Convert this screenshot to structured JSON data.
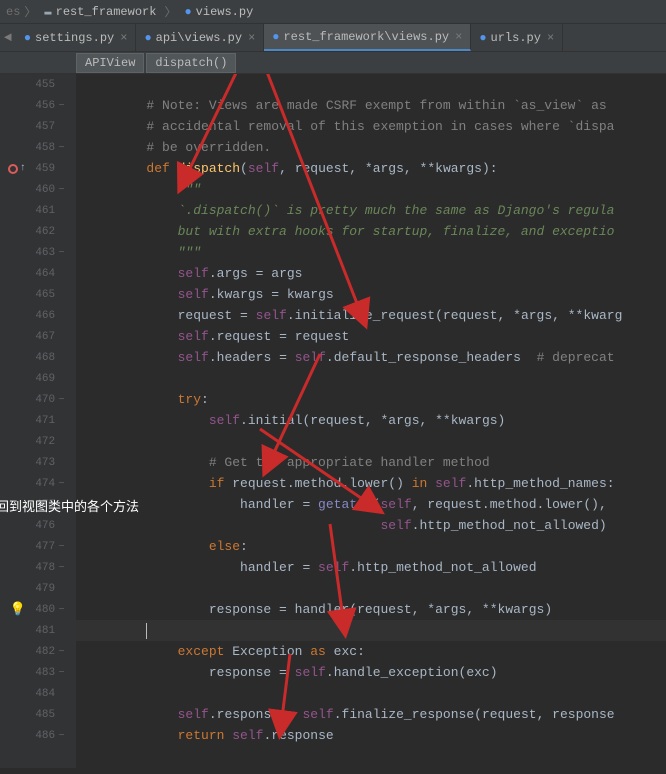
{
  "breadcrumb": {
    "part1": "rest_framework",
    "part2": "views.py",
    "left_chevron": "es"
  },
  "tabs": [
    {
      "label": "settings.py",
      "icon": "python",
      "active": false
    },
    {
      "label": "api\\views.py",
      "icon": "python",
      "active": false
    },
    {
      "label": "rest_framework\\views.py",
      "icon": "python",
      "active": true
    },
    {
      "label": "urls.py",
      "icon": "python",
      "active": false
    }
  ],
  "structure": [
    {
      "label": "APIView"
    },
    {
      "label": "dispatch()"
    }
  ],
  "annotation_text": "反射回到视图类中的各个方法",
  "lines": [
    {
      "num": "455",
      "tokens": []
    },
    {
      "num": "456",
      "fold": "−",
      "tokens": [
        [
          "comment",
          "        # Note: Views are made CSRF exempt from within `as_view` as "
        ]
      ]
    },
    {
      "num": "457",
      "tokens": [
        [
          "comment",
          "        # accidental removal of this exemption in cases where `dispa"
        ]
      ]
    },
    {
      "num": "458",
      "fold": "−",
      "tokens": [
        [
          "comment",
          "        # be overridden."
        ]
      ]
    },
    {
      "num": "459",
      "break": true,
      "override": true,
      "tokens": [
        [
          "keyword",
          "        def "
        ],
        [
          "funcname",
          "dispatch"
        ],
        [
          "punct",
          "("
        ],
        [
          "self",
          "self"
        ],
        [
          "punct",
          ", "
        ],
        [
          "param",
          "request"
        ],
        [
          "punct",
          ", *"
        ],
        [
          "param",
          "args"
        ],
        [
          "punct",
          ", **"
        ],
        [
          "param",
          "kwargs"
        ],
        [
          "punct",
          "):"
        ]
      ]
    },
    {
      "num": "460",
      "fold": "−",
      "tokens": [
        [
          "string",
          "            \"\"\""
        ]
      ]
    },
    {
      "num": "461",
      "tokens": [
        [
          "string",
          "            `.dispatch()` is pretty much the same as Django's regula"
        ]
      ]
    },
    {
      "num": "462",
      "tokens": [
        [
          "string",
          "            but with extra hooks for startup, finalize, and exceptio"
        ]
      ]
    },
    {
      "num": "463",
      "fold": "−",
      "tokens": [
        [
          "string",
          "            \"\"\""
        ]
      ]
    },
    {
      "num": "464",
      "tokens": [
        [
          "ident",
          "            "
        ],
        [
          "self",
          "self"
        ],
        [
          "punct",
          "."
        ],
        [
          "ident",
          "args "
        ],
        [
          "punct",
          "= "
        ],
        [
          "param",
          "args"
        ]
      ]
    },
    {
      "num": "465",
      "tokens": [
        [
          "ident",
          "            "
        ],
        [
          "self",
          "self"
        ],
        [
          "punct",
          "."
        ],
        [
          "ident",
          "kwargs "
        ],
        [
          "punct",
          "= "
        ],
        [
          "param",
          "kwargs"
        ]
      ]
    },
    {
      "num": "466",
      "tokens": [
        [
          "ident",
          "            request "
        ],
        [
          "punct",
          "= "
        ],
        [
          "self",
          "self"
        ],
        [
          "punct",
          "."
        ],
        [
          "ident",
          "initialize_request"
        ],
        [
          "punct",
          "("
        ],
        [
          "param",
          "request"
        ],
        [
          "punct",
          ", *"
        ],
        [
          "param",
          "args"
        ],
        [
          "punct",
          ", **"
        ],
        [
          "param",
          "kwarg"
        ]
      ]
    },
    {
      "num": "467",
      "tokens": [
        [
          "ident",
          "            "
        ],
        [
          "self",
          "self"
        ],
        [
          "punct",
          "."
        ],
        [
          "ident",
          "request "
        ],
        [
          "punct",
          "= "
        ],
        [
          "param",
          "request"
        ]
      ]
    },
    {
      "num": "468",
      "tokens": [
        [
          "ident",
          "            "
        ],
        [
          "self",
          "self"
        ],
        [
          "punct",
          "."
        ],
        [
          "ident",
          "headers "
        ],
        [
          "punct",
          "= "
        ],
        [
          "self",
          "self"
        ],
        [
          "punct",
          "."
        ],
        [
          "ident",
          "default_response_headers  "
        ],
        [
          "comment",
          "# deprecat"
        ]
      ]
    },
    {
      "num": "469",
      "tokens": []
    },
    {
      "num": "470",
      "fold": "−",
      "tokens": [
        [
          "ident",
          "            "
        ],
        [
          "keyword",
          "try"
        ],
        [
          "punct",
          ":"
        ]
      ]
    },
    {
      "num": "471",
      "tokens": [
        [
          "ident",
          "                "
        ],
        [
          "self",
          "self"
        ],
        [
          "punct",
          "."
        ],
        [
          "ident",
          "initial"
        ],
        [
          "punct",
          "("
        ],
        [
          "param",
          "request"
        ],
        [
          "punct",
          ", *"
        ],
        [
          "param",
          "args"
        ],
        [
          "punct",
          ", **"
        ],
        [
          "param",
          "kwargs"
        ],
        [
          "punct",
          ")"
        ]
      ]
    },
    {
      "num": "472",
      "tokens": []
    },
    {
      "num": "473",
      "tokens": [
        [
          "comment",
          "                # Get the appropriate handler method"
        ]
      ]
    },
    {
      "num": "474",
      "fold": "−",
      "tokens": [
        [
          "ident",
          "                "
        ],
        [
          "keyword",
          "if "
        ],
        [
          "param",
          "request"
        ],
        [
          "punct",
          "."
        ],
        [
          "ident",
          "method"
        ],
        [
          "punct",
          "."
        ],
        [
          "ident",
          "lower"
        ],
        [
          "punct",
          "() "
        ],
        [
          "keyword",
          "in "
        ],
        [
          "self",
          "self"
        ],
        [
          "punct",
          "."
        ],
        [
          "ident",
          "http_method_names"
        ],
        [
          "punct",
          ":"
        ]
      ]
    },
    {
      "num": "475",
      "tokens": [
        [
          "ident",
          "                    handler "
        ],
        [
          "punct",
          "= "
        ],
        [
          "builtin",
          "getattr"
        ],
        [
          "punct",
          "("
        ],
        [
          "self",
          "self"
        ],
        [
          "punct",
          ", "
        ],
        [
          "param",
          "request"
        ],
        [
          "punct",
          "."
        ],
        [
          "ident",
          "method"
        ],
        [
          "punct",
          "."
        ],
        [
          "ident",
          "lower"
        ],
        [
          "punct",
          "(),"
        ]
      ]
    },
    {
      "num": "476",
      "tokens": [
        [
          "ident",
          "                                      "
        ],
        [
          "self",
          "self"
        ],
        [
          "punct",
          "."
        ],
        [
          "ident",
          "http_method_not_allowed"
        ],
        [
          "punct",
          ")"
        ]
      ]
    },
    {
      "num": "477",
      "fold": "−",
      "tokens": [
        [
          "ident",
          "                "
        ],
        [
          "keyword",
          "else"
        ],
        [
          "punct",
          ":"
        ]
      ]
    },
    {
      "num": "478",
      "fold": "−",
      "tokens": [
        [
          "ident",
          "                    handler "
        ],
        [
          "punct",
          "= "
        ],
        [
          "self",
          "self"
        ],
        [
          "punct",
          "."
        ],
        [
          "ident",
          "http_method_not_allowed"
        ]
      ]
    },
    {
      "num": "479",
      "tokens": []
    },
    {
      "num": "480",
      "fold": "−",
      "bulb": true,
      "tokens": [
        [
          "ident",
          "                response "
        ],
        [
          "punct",
          "= "
        ],
        [
          "ident",
          "handler"
        ],
        [
          "punct",
          "("
        ],
        [
          "param",
          "request"
        ],
        [
          "punct",
          ", *"
        ],
        [
          "param",
          "args"
        ],
        [
          "punct",
          ", **"
        ],
        [
          "param",
          "kwargs"
        ],
        [
          "punct",
          ")"
        ]
      ]
    },
    {
      "num": "481",
      "current": true,
      "caret": true,
      "tokens": [
        [
          "ident",
          "        "
        ]
      ]
    },
    {
      "num": "482",
      "fold": "−",
      "tokens": [
        [
          "ident",
          "            "
        ],
        [
          "keyword",
          "except "
        ],
        [
          "ident",
          "Exception "
        ],
        [
          "keyword",
          "as "
        ],
        [
          "ident",
          "exc"
        ],
        [
          "punct",
          ":"
        ]
      ]
    },
    {
      "num": "483",
      "fold": "−",
      "tokens": [
        [
          "ident",
          "                response "
        ],
        [
          "punct",
          "= "
        ],
        [
          "self",
          "self"
        ],
        [
          "punct",
          "."
        ],
        [
          "ident",
          "handle_exception"
        ],
        [
          "punct",
          "("
        ],
        [
          "ident",
          "exc"
        ],
        [
          "punct",
          ")"
        ]
      ]
    },
    {
      "num": "484",
      "tokens": []
    },
    {
      "num": "485",
      "tokens": [
        [
          "ident",
          "            "
        ],
        [
          "self",
          "self"
        ],
        [
          "punct",
          "."
        ],
        [
          "ident",
          "response "
        ],
        [
          "punct",
          "= "
        ],
        [
          "self",
          "self"
        ],
        [
          "punct",
          "."
        ],
        [
          "ident",
          "finalize_response"
        ],
        [
          "punct",
          "("
        ],
        [
          "param",
          "request"
        ],
        [
          "punct",
          ", "
        ],
        [
          "ident",
          "response"
        ]
      ]
    },
    {
      "num": "486",
      "fold": "−",
      "tokens": [
        [
          "ident",
          "            "
        ],
        [
          "keyword",
          "return "
        ],
        [
          "self",
          "self"
        ],
        [
          "punct",
          "."
        ],
        [
          "ident",
          "response"
        ]
      ]
    }
  ]
}
